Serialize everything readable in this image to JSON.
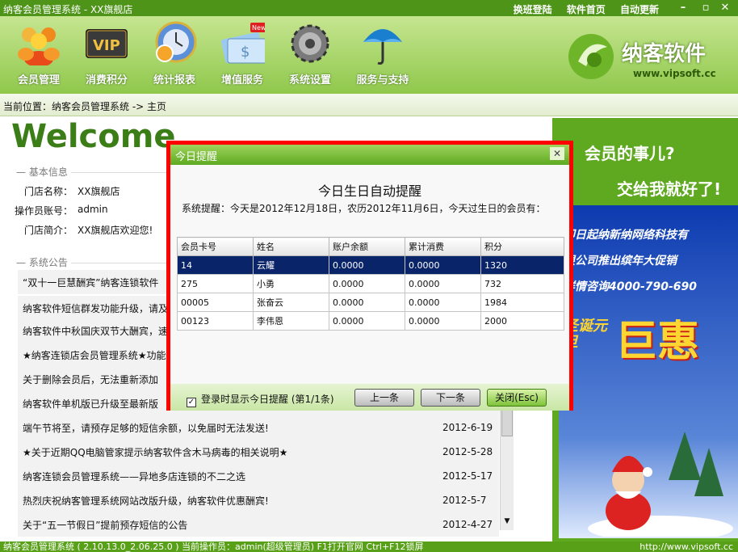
{
  "window": {
    "title": "纳客会员管理系统 - XX旗舰店",
    "links": [
      "换班登陆",
      "软件首页",
      "自动更新"
    ]
  },
  "toolbar": {
    "items": [
      {
        "label": "会员管理",
        "icon": "members-icon"
      },
      {
        "label": "消费积分",
        "icon": "vip-icon"
      },
      {
        "label": "统计报表",
        "icon": "stats-clock-icon"
      },
      {
        "label": "增值服务",
        "icon": "value-card-icon",
        "badge": "New"
      },
      {
        "label": "系统设置",
        "icon": "gear-icon"
      },
      {
        "label": "服务与支持",
        "icon": "umbrella-icon"
      }
    ],
    "brand": "纳客软件",
    "brand_url": "www.vipsoft.cc"
  },
  "breadcrumb": "当前位置：纳客会员管理系统 -> 主页",
  "main": {
    "welcome": "Welcome",
    "basic_title": "基本信息",
    "info": [
      {
        "label": "门店名称：",
        "value": "XX旗舰店"
      },
      {
        "label": "操作员账号：",
        "value": "admin"
      },
      {
        "label": "门店简介：",
        "value": "XX旗舰店欢迎您!"
      }
    ],
    "notice_title": "系统公告",
    "news": [
      {
        "title": "“双十一巨慧酬宾”纳客连锁软件",
        "date": ""
      },
      {
        "title": "纳客软件短信群发功能升级，请及",
        "date": ""
      },
      {
        "title": "纳客软件中秋国庆双节大酬宾，速",
        "date": ""
      },
      {
        "title": "★纳客连锁店会员管理系统★功能",
        "date": ""
      },
      {
        "title": "关于删除会员后，无法重新添加",
        "date": ""
      },
      {
        "title": "纳客软件单机版已升级至最新版",
        "date": ""
      },
      {
        "title": "端午节将至，请预存足够的短信余额，以免届时无法发送!",
        "date": "2012-6-19"
      },
      {
        "title": "★关于近期QQ电脑管家提示纳客软件含木马病毒的相关说明★",
        "date": "2012-5-28"
      },
      {
        "title": "纳客连锁会员管理系统——异地多店连锁的不二之选",
        "date": "2012-5-17"
      },
      {
        "title": "热烈庆祝纳客管理系统网站改版升级，纳客软件优惠酬宾!",
        "date": "2012-5-7"
      },
      {
        "title": "关于“五一节假日”提前预存短信的公告",
        "date": "2012-4-27"
      }
    ]
  },
  "ad": {
    "line1": "会员的事儿?",
    "line2": "交给我就好了!",
    "lines": [
      "即日起纳新纳网络科技有",
      "限公司推出缤年大促销",
      "详情咨询4000-790-690"
    ],
    "big": "巨惠",
    "side": "圣诞元旦"
  },
  "dialog": {
    "title": "今日提醒",
    "heading": "今日生日自动提醒",
    "message": "系统提醒：今天是2012年12月18日，农历2012年11月6日，今天过生日的会员有：",
    "columns": [
      "会员卡号",
      "姓名",
      "账户余额",
      "累计消费",
      "积分"
    ],
    "rows": [
      [
        "14",
        "云耀",
        "0.0000",
        "0.0000",
        "1320"
      ],
      [
        "275",
        "小勇",
        "0.0000",
        "0.0000",
        "732"
      ],
      [
        "00005",
        "张奋云",
        "0.0000",
        "0.0000",
        "1984"
      ],
      [
        "00123",
        "李伟恩",
        "0.0000",
        "0.0000",
        "2000"
      ]
    ],
    "checkbox_label": "登录时显示今日提醒",
    "page_info": "(第1/1条)",
    "prev": "上一条",
    "next": "下一条",
    "close": "关闭(Esc)"
  },
  "status": {
    "text": "纳客会员管理系统 ( 2.10.13.0_2.06.25.0 )  当前操作员：admin(超级管理员)  F1打开官网 Ctrl+F12锁屏",
    "url": "http://www.vipsoft.cc"
  }
}
